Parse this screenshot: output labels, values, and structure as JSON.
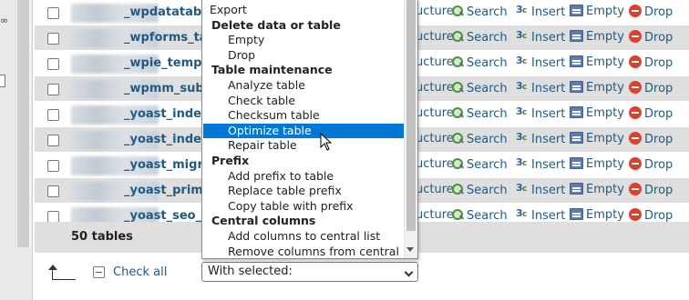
{
  "rows": [
    {
      "name": "_wpdatatables",
      "shade": "odd"
    },
    {
      "name": "_wpforms_tas",
      "shade": "even"
    },
    {
      "name": "_wpie_templat",
      "shade": "odd"
    },
    {
      "name": "_wpmm_subsc",
      "shade": "even"
    },
    {
      "name": "_yoast_indexa",
      "shade": "odd"
    },
    {
      "name": "_yoast_indexa",
      "shade": "even"
    },
    {
      "name": "_yoast_migrat",
      "shade": "odd"
    },
    {
      "name": "_yoast_primar",
      "shade": "even"
    },
    {
      "name": "_yoast_seo_lin",
      "shade": "odd"
    }
  ],
  "actions": {
    "structure": "ucture",
    "search": "Search",
    "insert": "Insert",
    "empty": "Empty",
    "drop": "Drop"
  },
  "footer": {
    "table_count": "50 tables",
    "check_all": "Check all",
    "with_selected": "With selected:"
  },
  "dropdown": {
    "options": [
      {
        "label": "Export",
        "kind": "item"
      },
      {
        "label": "Delete data or table",
        "kind": "group"
      },
      {
        "label": "Empty",
        "kind": "sub"
      },
      {
        "label": "Drop",
        "kind": "sub"
      },
      {
        "label": "Table maintenance",
        "kind": "group"
      },
      {
        "label": "Analyze table",
        "kind": "sub"
      },
      {
        "label": "Check table",
        "kind": "sub"
      },
      {
        "label": "Checksum table",
        "kind": "sub"
      },
      {
        "label": "Optimize table",
        "kind": "sub",
        "selected": true
      },
      {
        "label": "Repair table",
        "kind": "sub"
      },
      {
        "label": "Prefix",
        "kind": "group"
      },
      {
        "label": "Add prefix to table",
        "kind": "sub"
      },
      {
        "label": "Replace table prefix",
        "kind": "sub"
      },
      {
        "label": "Copy table with prefix",
        "kind": "sub"
      },
      {
        "label": "Central columns",
        "kind": "group"
      },
      {
        "label": "Add columns to central list",
        "kind": "sub"
      },
      {
        "label": "Remove columns from central list",
        "kind": "sub"
      }
    ]
  },
  "colors": {
    "link": "#235a81",
    "row_alt": "#dfdfdf",
    "selected": "#0078d7"
  }
}
